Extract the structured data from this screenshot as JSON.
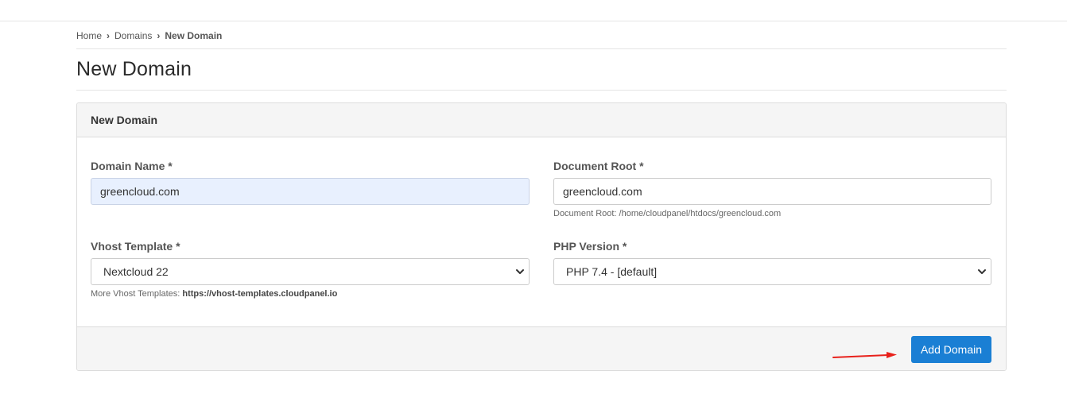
{
  "breadcrumb": {
    "items": [
      "Home",
      "Domains",
      "New Domain"
    ]
  },
  "page": {
    "title": "New Domain"
  },
  "form": {
    "header": "New Domain",
    "domain_name": {
      "label": "Domain Name *",
      "value": "greencloud.com"
    },
    "document_root": {
      "label": "Document Root *",
      "value": "greencloud.com",
      "help": "Document Root: /home/cloudpanel/htdocs/greencloud.com"
    },
    "vhost_template": {
      "label": "Vhost Template *",
      "selected": "Nextcloud 22",
      "help_prefix": "More Vhost Templates: ",
      "help_link": "https://vhost-templates.cloudpanel.io"
    },
    "php_version": {
      "label": "PHP Version *",
      "selected": "PHP 7.4 - [default]"
    },
    "submit_label": "Add Domain"
  },
  "colors": {
    "primary_button": "#1a7fd4",
    "annotation_arrow": "#e8211b",
    "autofill_bg": "#e8f0fe"
  },
  "icons": {
    "breadcrumb_separator": "chevron-right-icon",
    "select_caret": "chevron-down-icon"
  }
}
